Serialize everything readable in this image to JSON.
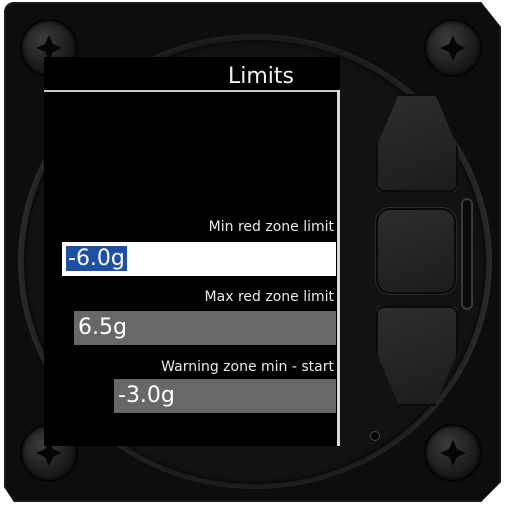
{
  "screen": {
    "title": "Limits",
    "fields": [
      {
        "label": "Min red zone limit",
        "value": "-6.0g",
        "state": "active"
      },
      {
        "label": "Max red zone limit",
        "value": "6.5g",
        "state": "inactive"
      },
      {
        "label": "Warning zone min - start",
        "value": "-3.0g",
        "state": "inactive"
      }
    ]
  },
  "colors": {
    "screen_bg": "#000000",
    "active_field_bg": "#ffffff",
    "selection_bg": "#1d4fa3",
    "inactive_field_bg": "#686868",
    "bezel": "#0d0d0e"
  },
  "icons": [
    "screw-icon",
    "up-button",
    "enter-button",
    "down-button"
  ]
}
